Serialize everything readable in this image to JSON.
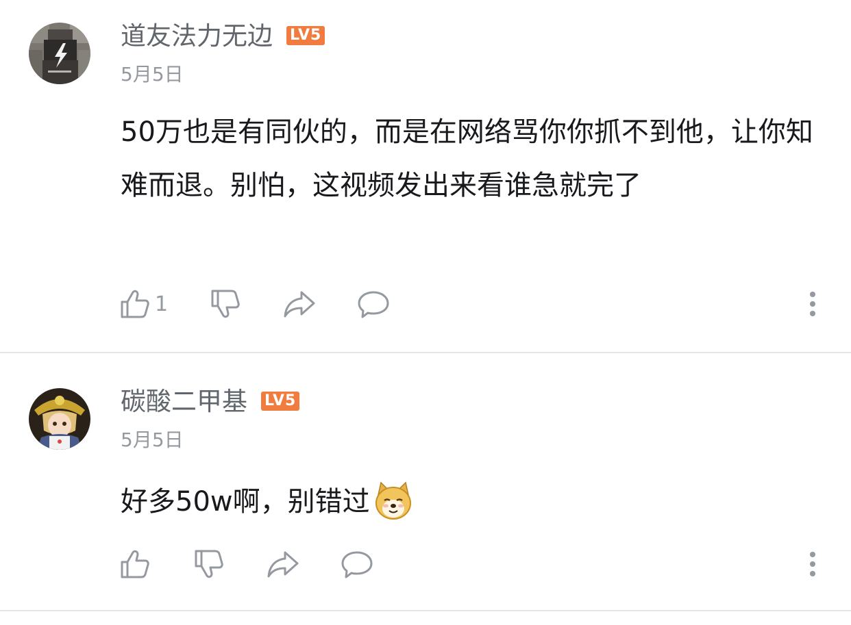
{
  "comments": [
    {
      "username": "道友法力无边",
      "level": "LV5",
      "date": "5月5日",
      "content": "50万也是有同伙的，而是在网络骂你你抓不到他，让你知难而退。别怕，这视频发出来看谁急就完了",
      "like_count": "1",
      "avatar_icon": "pixelated-avatar-lightning"
    },
    {
      "username": "碳酸二甲基",
      "level": "LV5",
      "date": "5月5日",
      "content": "好多50w啊，别错过",
      "like_count": "",
      "avatar_icon": "anime-girl-avatar",
      "emoji": "doge-emoji"
    }
  ],
  "colors": {
    "level_badge": "#f07d3f",
    "username": "#61666d",
    "meta": "#9499a0",
    "content": "#18191c",
    "divider": "#e3e5e7"
  }
}
